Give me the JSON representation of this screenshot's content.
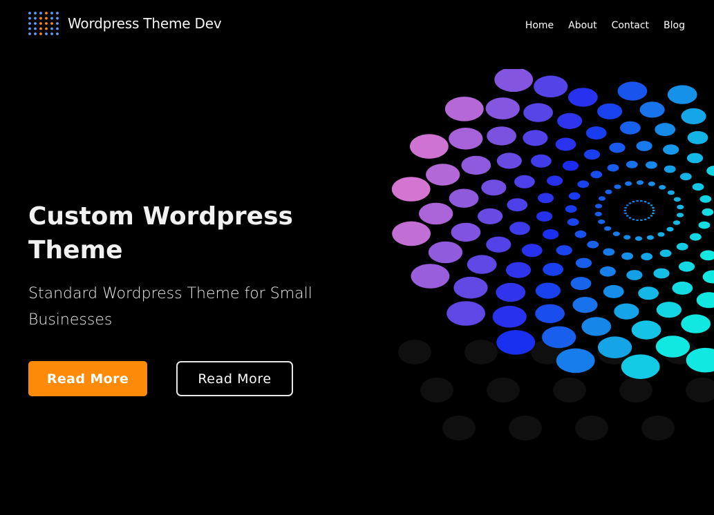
{
  "header": {
    "brand": "Wordpress Theme Dev",
    "logo_icon": "dotted-grid-logo-icon",
    "nav": [
      "Home",
      "About",
      "Contact",
      "Blog"
    ]
  },
  "hero": {
    "title": "Custom Wordpress Theme",
    "subtitle": "Standard Wordpress Theme for Small Businesses",
    "primary_button": "Read More",
    "secondary_button": "Read More",
    "art_icon": "dotted-spiral-graphic"
  },
  "colors": {
    "accent": "#fd8a08",
    "background": "#000000",
    "dots_from": "#e07ad0",
    "dots_mid": "#1a2cf0",
    "dots_to": "#12e8e2"
  }
}
